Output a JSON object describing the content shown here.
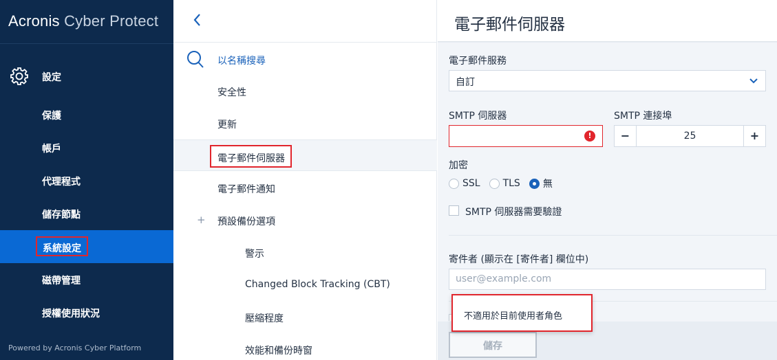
{
  "sidebar": {
    "brand_primary": "Acronis",
    "brand_secondary": "Cyber Protect",
    "settings_label": "設定",
    "items": [
      {
        "label": "保護"
      },
      {
        "label": "帳戶"
      },
      {
        "label": "代理程式"
      },
      {
        "label": "儲存節點"
      },
      {
        "label": "系統設定",
        "active": true
      },
      {
        "label": "磁帶管理"
      },
      {
        "label": "授權使用狀況"
      }
    ],
    "footer": "Powered by Acronis Cyber Platform"
  },
  "middle": {
    "search_placeholder": "以名稱搜尋",
    "items": [
      {
        "label": "安全性"
      },
      {
        "label": "更新"
      },
      {
        "label": "電子郵件伺服器",
        "selected": true
      },
      {
        "label": "電子郵件通知"
      },
      {
        "label": "預設備份選項",
        "expander": "+"
      },
      {
        "label": "警示"
      },
      {
        "label": "Changed Block Tracking (CBT)"
      },
      {
        "label": "壓縮程度"
      },
      {
        "label": "效能和備份時窗"
      }
    ]
  },
  "panel": {
    "title": "電子郵件伺服器",
    "email_service_label": "電子郵件服務",
    "email_service_value": "自訂",
    "smtp_server_label": "SMTP 伺服器",
    "smtp_server_value": "",
    "smtp_error_glyph": "!",
    "smtp_port_label": "SMTP 連接埠",
    "smtp_port_value": "25",
    "stepper_minus": "−",
    "stepper_plus": "+",
    "encryption_label": "加密",
    "encryption_options": [
      "SSL",
      "TLS",
      "無"
    ],
    "encryption_selected": "無",
    "auth_required_label": "SMTP 伺服器需要驗證",
    "auth_required_checked": false,
    "sender_label": "寄件者 (顯示在 [寄件者] 欄位中)",
    "sender_placeholder": "user@example.com",
    "tooltip": "不適用於目前使用者角色",
    "save_label": "儲存"
  },
  "colors": {
    "sidebar_bg": "#0d2a4d",
    "active_item_bg": "#0a69d4",
    "highlight_border": "#e1252c",
    "link_blue": "#1a62ba",
    "panel_bg": "#f2f5f9"
  },
  "icons": {
    "settings": "gear-icon",
    "back": "chevron-left-icon",
    "search": "search-icon",
    "dropdown": "chevron-down-icon",
    "error": "error-icon"
  }
}
